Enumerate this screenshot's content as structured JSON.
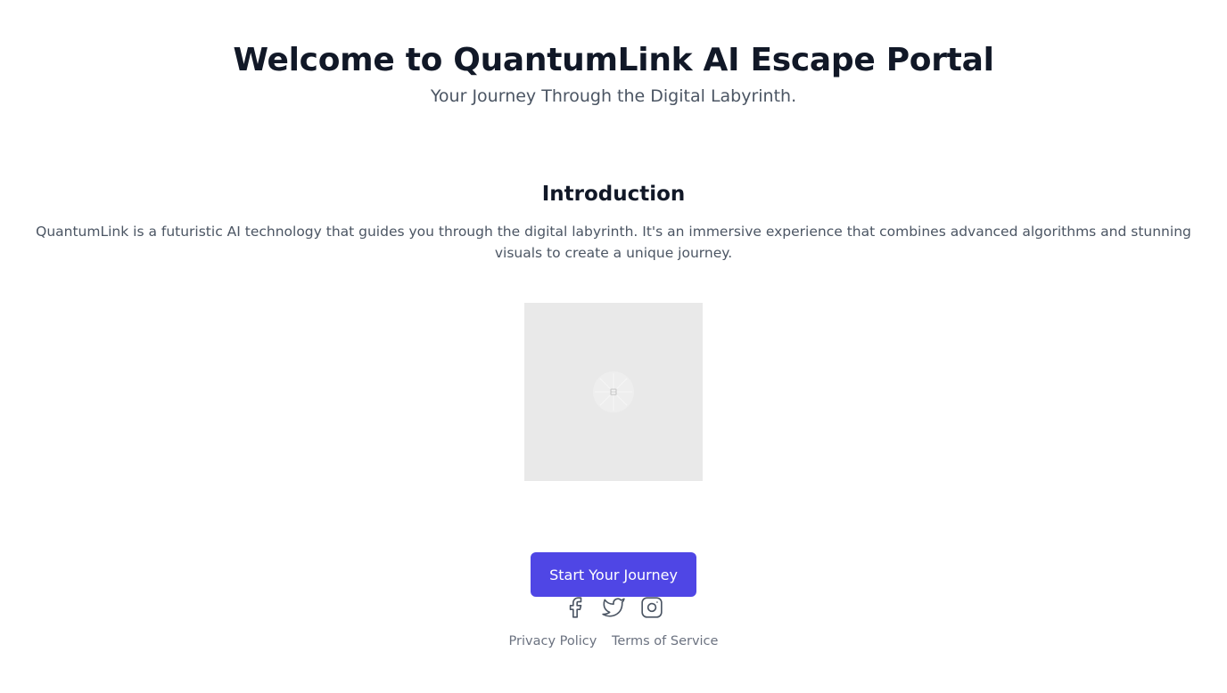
{
  "header": {
    "title": "Welcome to QuantumLink AI Escape Portal",
    "subtitle": "Your Journey Through the Digital Labyrinth."
  },
  "intro": {
    "heading": "Introduction",
    "text": "QuantumLink is a futuristic AI technology that guides you through the digital labyrinth. It's an immersive experience that combines advanced algorithms and stunning visuals to create a unique journey."
  },
  "cta": {
    "label": "Start Your Journey"
  },
  "social": {
    "icons": [
      "facebook-icon",
      "twitter-icon",
      "instagram-icon"
    ]
  },
  "footer": {
    "privacy_label": "Privacy Policy",
    "terms_label": "Terms of Service"
  },
  "colors": {
    "primary": "#4f46e5",
    "heading": "#111827",
    "body_text": "#4b5563",
    "footer_text": "#6b7280",
    "placeholder_bg": "#e9e9e9"
  }
}
